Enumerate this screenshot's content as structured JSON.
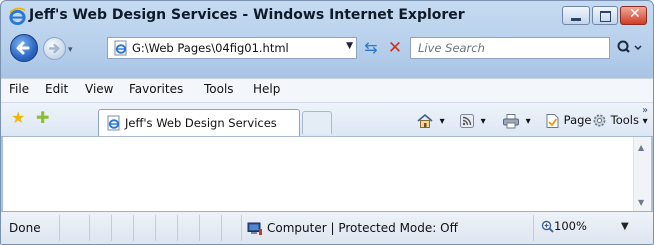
{
  "window": {
    "title": "Jeff's Web Design Services - Windows Internet Explorer",
    "controls": {
      "minimize": "minimize-icon",
      "maximize": "maximize-icon",
      "close": "close-icon"
    }
  },
  "address_bar": {
    "url": "G:\\Web Pages\\04fig01.html",
    "dropdown_glyph": "▼",
    "refresh_glyph": "⇆",
    "stop_glyph": "✕"
  },
  "search": {
    "placeholder": "Live Search",
    "glyph": "⚲"
  },
  "nav": {
    "dropdown_glyph": "▾"
  },
  "menu": {
    "items": [
      "File",
      "Edit",
      "View",
      "Favorites",
      "Tools",
      "Help"
    ]
  },
  "tabs": [
    {
      "label": "Jeff's Web Design Services"
    }
  ],
  "command_bar": {
    "page_label": "Page",
    "tools_label": "Tools",
    "dropdown_glyph": "▾",
    "overflow_glyph": "»"
  },
  "statusbar": {
    "status": "Done",
    "zone": "Computer | Protected Mode: Off",
    "zoom": "100%",
    "zoom_dropdown_glyph": "▼"
  },
  "colors": {
    "frame": "#b9d1ec",
    "accent": "#2b66c4",
    "close_button": "#cf3d26"
  }
}
